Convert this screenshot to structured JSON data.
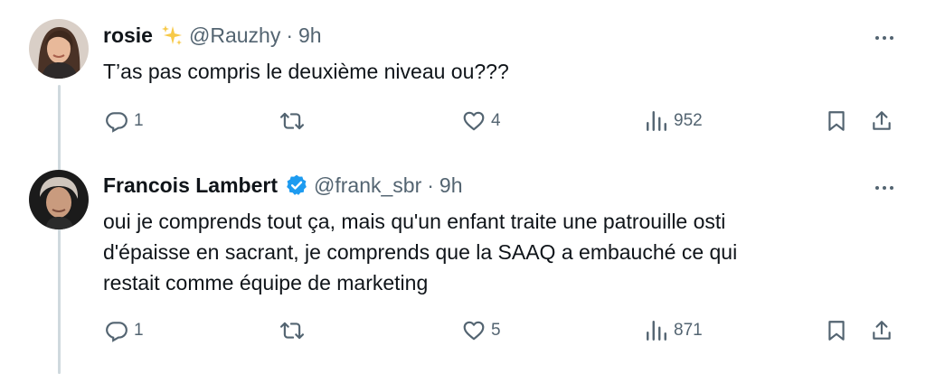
{
  "tweets": [
    {
      "name": "rosie",
      "badge": "sparkles-emoji",
      "handle": "@Rauzhy",
      "separator": "·",
      "time": "9h",
      "text": "T’as pas compris le deuxième niveau ou???",
      "replies": "1",
      "retweets": "",
      "likes": "4",
      "views": "952"
    },
    {
      "name": "Francois Lambert",
      "badge": "verified-badge",
      "handle": "@frank_sbr",
      "separator": "·",
      "time": "9h",
      "text": "oui je comprends tout ça, mais qu'un enfant traite une patrouille osti\nd'épaisse en sacrant, je comprends que la SAAQ a embauché ce qui\nrestait comme équipe de marketing",
      "replies": "1",
      "retweets": "",
      "likes": "5",
      "views": "871"
    }
  ],
  "colors": {
    "text": "#0f1419",
    "secondary": "#536471",
    "verified": "#1d9bf0",
    "thread_line": "#cfd9de"
  }
}
